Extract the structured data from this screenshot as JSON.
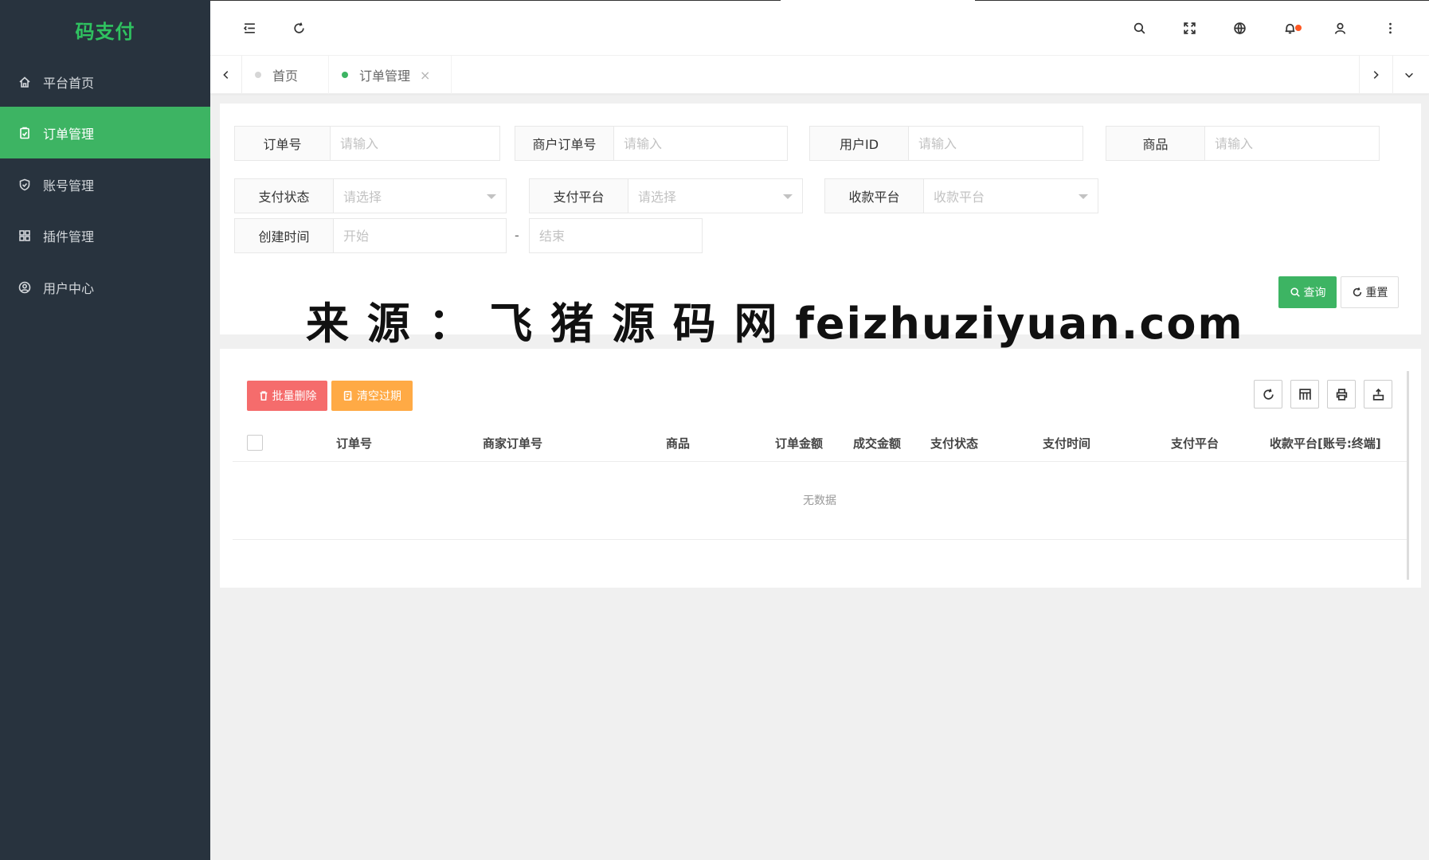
{
  "app": {
    "logo": "码支付"
  },
  "sidebar": {
    "items": [
      {
        "label": "平台首页",
        "icon": "home-icon"
      },
      {
        "label": "订单管理",
        "icon": "clipboard-icon",
        "active": true
      },
      {
        "label": "账号管理",
        "icon": "shield-icon"
      },
      {
        "label": "插件管理",
        "icon": "grid-icon"
      },
      {
        "label": "用户中心",
        "icon": "user-circle-icon"
      }
    ]
  },
  "header": {
    "icons": [
      "menu-fold-icon",
      "refresh-icon",
      "search-icon",
      "fullscreen-icon",
      "globe-icon",
      "bell-icon",
      "user-icon",
      "more-vertical-icon"
    ]
  },
  "tabs": [
    {
      "label": "首页",
      "active": false
    },
    {
      "label": "订单管理",
      "active": true,
      "close": "×"
    }
  ],
  "filters": {
    "order_no": {
      "label": "订单号",
      "placeholder": "请输入"
    },
    "merchant_order_no": {
      "label": "商户订单号",
      "placeholder": "请输入"
    },
    "user_id": {
      "label": "用户ID",
      "placeholder": "请输入"
    },
    "product": {
      "label": "商品",
      "placeholder": "请输入"
    },
    "pay_status": {
      "label": "支付状态",
      "placeholder": "请选择"
    },
    "pay_platform": {
      "label": "支付平台",
      "placeholder": "请选择"
    },
    "receive_platform": {
      "label": "收款平台",
      "placeholder": "收款平台"
    },
    "created_time": {
      "label": "创建时间",
      "start_placeholder": "开始",
      "separator": "-",
      "end_placeholder": "结束"
    },
    "search_label": "查询",
    "reset_label": "重置"
  },
  "watermark": "来 源 ： 飞 猪 源 码 网 feizhuziyuan.com",
  "table": {
    "batch_delete_label": "批量删除",
    "clear_expired_label": "清空过期",
    "columns": [
      "订单号",
      "商家订单号",
      "商品",
      "订单金额",
      "成交金额",
      "支付状态",
      "支付时间",
      "支付平台",
      "收款平台[账号:终端]"
    ],
    "empty_text": "无数据",
    "tools": [
      "refresh-icon",
      "columns-icon",
      "print-icon",
      "export-icon"
    ]
  },
  "colors": {
    "accent": "#3db463",
    "sidebar_bg": "#28333e",
    "logo": "#2fc260",
    "danger": "#f56c6c",
    "warning": "#ffaa45",
    "badge": "#ff5722"
  }
}
